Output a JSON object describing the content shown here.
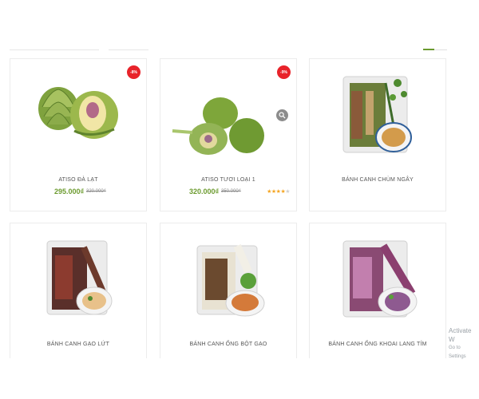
{
  "products": [
    {
      "name": "ATISO ĐÀ LẠT",
      "badge": "-8%",
      "price": "295.000₫",
      "old_price": "320.000₫"
    },
    {
      "name": "ATISO TƯƠI LOẠI 1",
      "badge": "-9%",
      "price": "320.000₫",
      "old_price": "350.000₫",
      "rating": 4
    },
    {
      "name": "BÁNH CANH CHÙM NGÂY"
    },
    {
      "name": "BÁNH CANH GẠO LỨT"
    },
    {
      "name": "BÁNH CANH ỐNG BỘT GẠO"
    },
    {
      "name": "BÁNH CANH ỐNG KHOAI LANG TÍM"
    }
  ],
  "windows_watermark": {
    "line1": "Activate W",
    "line2": "Go to Settings"
  },
  "colors": {
    "price": "#6c9b2f",
    "badge": "#e8232a",
    "star": "#f5a623"
  },
  "icons": {
    "zoom": "search-icon"
  }
}
